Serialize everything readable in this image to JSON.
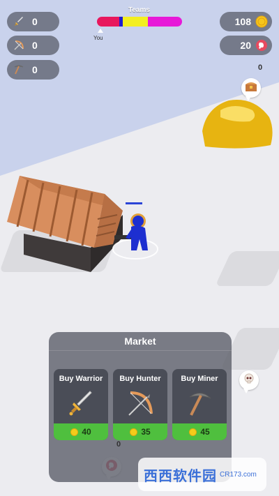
{
  "hud": {
    "swords": {
      "value": "0",
      "icon": "sword-icon"
    },
    "bows": {
      "value": "0",
      "icon": "bow-icon"
    },
    "pickaxes": {
      "value": "0",
      "icon": "pickaxe-icon"
    },
    "coins": {
      "value": "108",
      "icon": "coin-icon"
    },
    "meat": {
      "value": "20",
      "icon": "meat-icon"
    }
  },
  "teams": {
    "label": "Teams",
    "you_label": "You",
    "colors": [
      "#e8175d",
      "#1f1fd1",
      "#f3ef20",
      "#e719d8"
    ]
  },
  "world": {
    "gold_counter": "0",
    "market_counter": "0"
  },
  "market": {
    "title": "Market",
    "items": [
      {
        "label": "Buy Warrior",
        "price": "40",
        "icon": "sword-icon"
      },
      {
        "label": "Buy Hunter",
        "price": "35",
        "icon": "bow-icon"
      },
      {
        "label": "Buy Miner",
        "price": "45",
        "icon": "pickaxe-icon"
      }
    ]
  },
  "watermark": {
    "brand": "西西软件园",
    "domain": "CR173.com"
  }
}
